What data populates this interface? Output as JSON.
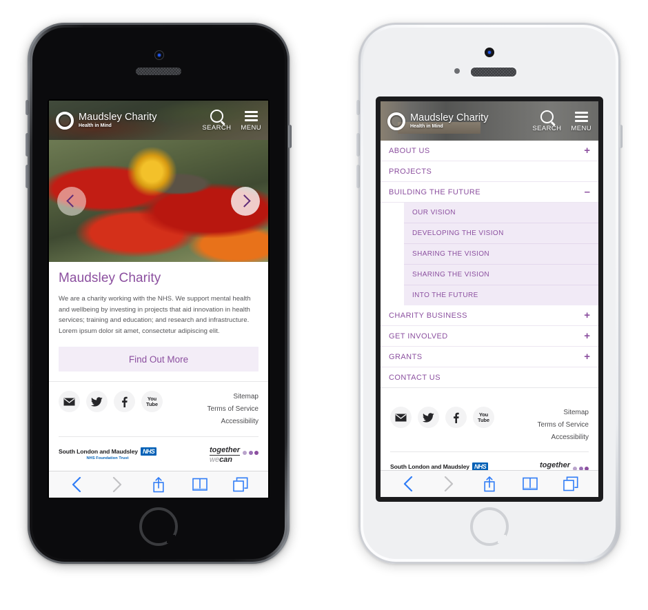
{
  "meta": {
    "accent_purple": "#8b4f9f",
    "chevron_purple": "#5f2c78",
    "submenu_bg": "#f1eaf6",
    "cta_bg": "#f3edf7",
    "safari_blue": "#2f7cf6",
    "nhs_blue": "#0060b6"
  },
  "site": {
    "logo_title": "Maudsley Charity",
    "logo_subtitle": "Health in Mind",
    "logo_icon": "ring-logo-icon",
    "search_label": "SEARCH",
    "menu_label": "MENU",
    "search_icon": "search-icon",
    "menu_icon": "hamburger-icon"
  },
  "hero": {
    "prev_icon": "chevron-left-icon",
    "next_icon": "chevron-right-icon",
    "image_alt": "bee-on-red-flower"
  },
  "intro": {
    "heading": "Maudsley Charity",
    "body": "We are a charity working with the NHS. We support mental health and wellbeing by investing in projects that aid innovation in health services; training and education; and research and infrastructure. Lorem ipsum dolor sit amet, consectetur adipiscing elit.",
    "cta_label": "Find Out More"
  },
  "menu": {
    "items": [
      {
        "label": "ABOUT US",
        "toggle": "+",
        "expanded": false
      },
      {
        "label": "PROJECTS",
        "toggle": "",
        "expanded": false
      },
      {
        "label": "BUILDING THE FUTURE",
        "toggle": "–",
        "expanded": true
      },
      {
        "label": "CHARITY BUSINESS",
        "toggle": "+",
        "expanded": false
      },
      {
        "label": "GET INVOLVED",
        "toggle": "+",
        "expanded": false
      },
      {
        "label": "GRANTS",
        "toggle": "+",
        "expanded": false
      },
      {
        "label": "CONTACT US",
        "toggle": "",
        "expanded": false
      }
    ],
    "submenu": [
      {
        "label": "OUR VISION"
      },
      {
        "label": "DEVELOPING THE VISION"
      },
      {
        "label": "SHARING THE VISION"
      },
      {
        "label": "SHARING THE VISION"
      },
      {
        "label": "INTO THE FUTURE"
      }
    ]
  },
  "footer": {
    "socials": [
      {
        "name": "email-icon",
        "label": "Email"
      },
      {
        "name": "twitter-icon",
        "label": "Twitter"
      },
      {
        "name": "facebook-icon",
        "label": "Facebook"
      },
      {
        "name": "youtube-icon",
        "label": "You Tube",
        "line1": "You",
        "line2": "Tube"
      }
    ],
    "links": [
      "Sitemap",
      "Terms of Service",
      "Accessibility"
    ],
    "nhs": {
      "text": "South London and Maudsley",
      "badge": "NHS",
      "sub": "NHS Foundation Trust"
    },
    "together": {
      "line1": "together",
      "line2_a": "we",
      "line2_b": "can",
      "dots": [
        "#b9a3cb",
        "#9a6fb5",
        "#8b4f9f"
      ]
    }
  },
  "safari": {
    "buttons": [
      {
        "name": "back-button",
        "icon": "chevron-left-icon",
        "state": "enabled"
      },
      {
        "name": "forward-button",
        "icon": "chevron-right-icon",
        "state": "disabled"
      },
      {
        "name": "share-button",
        "icon": "share-icon",
        "state": "enabled"
      },
      {
        "name": "bookmarks-button",
        "icon": "book-icon",
        "state": "enabled"
      },
      {
        "name": "tabs-button",
        "icon": "tabs-icon",
        "state": "enabled"
      }
    ]
  },
  "devices": [
    {
      "name": "iphone-black",
      "color": "Space Gray",
      "view": "homepage"
    },
    {
      "name": "iphone-white",
      "color": "Silver",
      "view": "menu-expanded"
    }
  ]
}
